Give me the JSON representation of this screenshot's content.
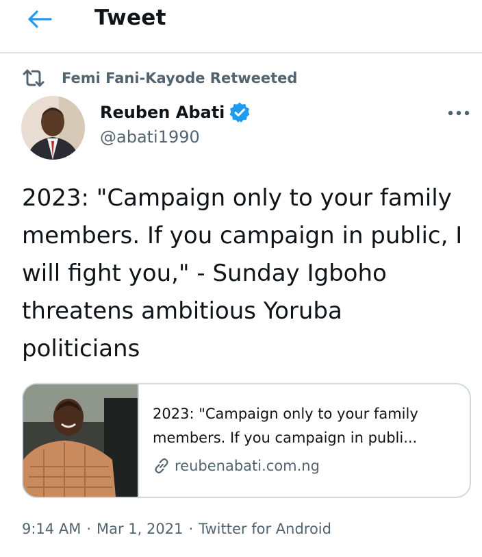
{
  "header": {
    "title": "Tweet",
    "back_icon": "arrow-left-icon",
    "accent_color": "#1d9bf0"
  },
  "retweet": {
    "icon": "retweet-icon",
    "text": "Femi Fani-Kayode Retweeted"
  },
  "author": {
    "name": "Reuben Abati",
    "handle": "@abati1990",
    "verified_icon": "verified-badge-icon"
  },
  "tweet": {
    "text": "2023: \"Campaign only to your family members. If you campaign in public, I will fight you,\" - Sunday Igboho threatens ambitious Yoruba politicians"
  },
  "card": {
    "title": "2023: \"Campaign only to your family members. If you campaign in publi...",
    "domain": "reubenabati.com.ng",
    "link_icon": "link-icon"
  },
  "meta": {
    "time": "9:14 AM",
    "separator": "·",
    "date": "Mar 1, 2021",
    "source": "Twitter for Android"
  }
}
